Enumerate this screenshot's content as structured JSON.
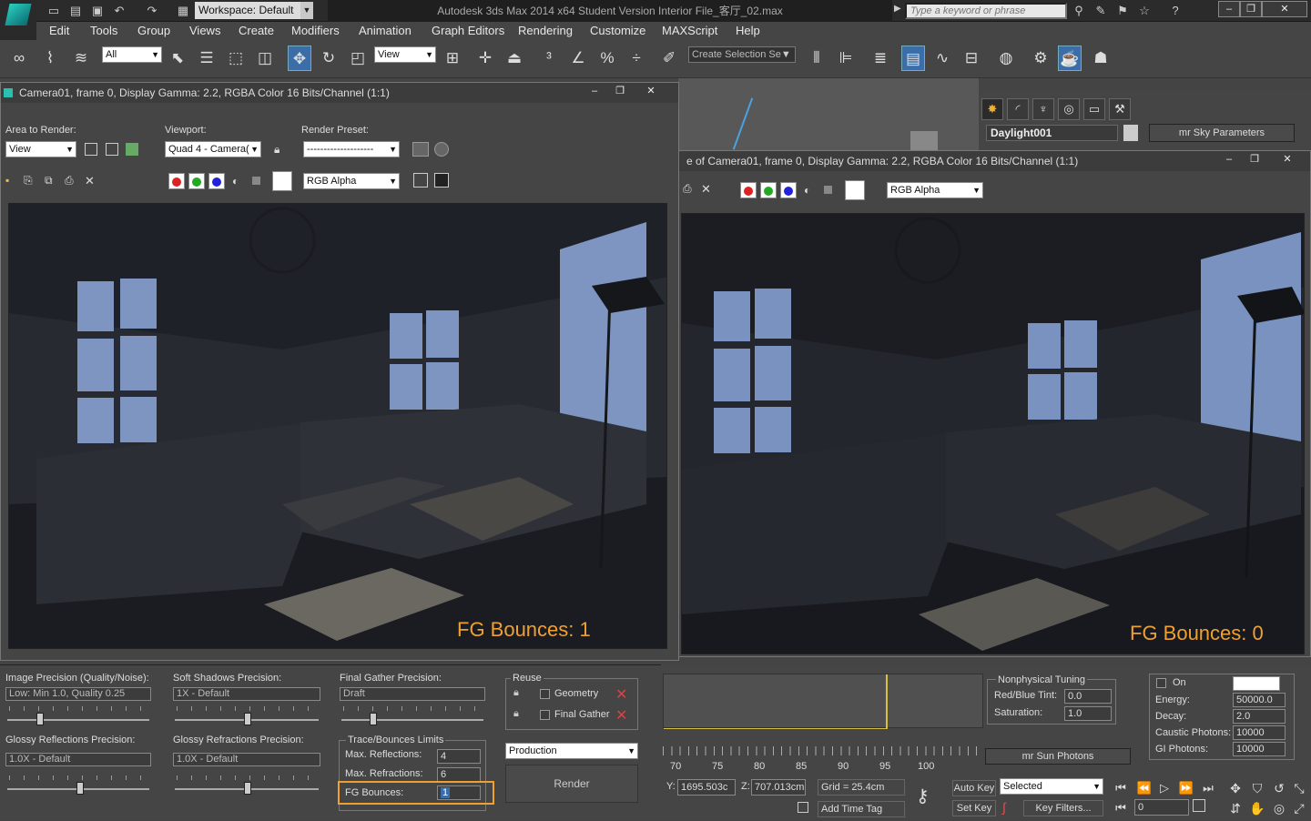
{
  "app": {
    "workspace": "Workspace: Default",
    "title": "Autodesk 3ds Max  2014 x64    Student Version    Interior File_客厅_02.max",
    "search_placeholder": "Type a keyword or phrase"
  },
  "menu": [
    "Edit",
    "Tools",
    "Group",
    "Views",
    "Create",
    "Modifiers",
    "Animation",
    "Graph Editors",
    "Rendering",
    "Customize",
    "MAXScript",
    "Help"
  ],
  "toolbar": {
    "filter_value": "All",
    "ref_coord": "View",
    "selection_set_placeholder": "Create Selection Se"
  },
  "command_panel": {
    "object_name": "Daylight001",
    "rollout": "mr Sky Parameters",
    "sun_photons_rollout": "mr Sun Photons",
    "nonphysical": {
      "title": "Nonphysical Tuning",
      "red_blue_label": "Red/Blue Tint:",
      "red_blue_value": "0.0",
      "saturation_label": "Saturation:",
      "saturation_value": "1.0"
    },
    "sun_photons": {
      "on_label": "On",
      "energy_label": "Energy:",
      "energy_value": "50000.0",
      "decay_label": "Decay:",
      "decay_value": "2.0",
      "caustic_label": "Caustic Photons:",
      "caustic_value": "10000",
      "gi_label": "GI Photons:",
      "gi_value": "10000"
    }
  },
  "render_window_left": {
    "title": "Camera01, frame 0, Display Gamma: 2.2, RGBA Color 16 Bits/Channel (1:1)",
    "area_label": "Area to Render:",
    "area_value": "View",
    "viewport_label": "Viewport:",
    "viewport_value": "Quad 4 - Camera(",
    "preset_label": "Render Preset:",
    "preset_value": "--------------------",
    "channel_value": "RGB Alpha",
    "overlay": "FG Bounces: 1"
  },
  "render_window_right": {
    "title": "e of Camera01, frame 0, Display Gamma: 2.2, RGBA Color 16 Bits/Channel (1:1)",
    "channel_value": "RGB Alpha",
    "overlay": "FG Bounces: 0"
  },
  "bottom_panel": {
    "image_precision_label": "Image Precision (Quality/Noise):",
    "image_precision_value": "Low: Min 1.0, Quality 0.25",
    "soft_shadows_label": "Soft Shadows Precision:",
    "soft_shadows_value": "1X - Default",
    "fg_precision_label": "Final Gather Precision:",
    "fg_precision_value": "Draft",
    "glossy_refl_label": "Glossy Reflections Precision:",
    "glossy_refl_value": "1.0X - Default",
    "glossy_refr_label": "Glossy Refractions Precision:",
    "glossy_refr_value": "1.0X - Default",
    "trace_title": "Trace/Bounces Limits",
    "max_refl_label": "Max. Reflections:",
    "max_refl_value": "4",
    "max_refr_label": "Max. Refractions:",
    "max_refr_value": "6",
    "fg_bounces_label": "FG Bounces:",
    "fg_bounces_value": "1",
    "reuse_title": "Reuse",
    "geometry_label": "Geometry",
    "final_gather_label": "Final Gather",
    "production_value": "Production",
    "render_button": "Render"
  },
  "status": {
    "y_label": "Y:",
    "y_value": "1695.503c",
    "z_label": "Z:",
    "z_value": "707.013cm",
    "grid": "Grid = 25.4cm",
    "add_time_tag": "Add Time Tag",
    "auto_key": "Auto Key",
    "set_key": "Set Key",
    "selected_value": "Selected",
    "key_filters": "Key Filters...",
    "frame_value": "0",
    "timeline_ticks": [
      "70",
      "75",
      "80",
      "85",
      "90",
      "95",
      "100"
    ]
  },
  "colors": {
    "accent_orange": "#f0a030",
    "active_blue": "#3b6ea8"
  }
}
